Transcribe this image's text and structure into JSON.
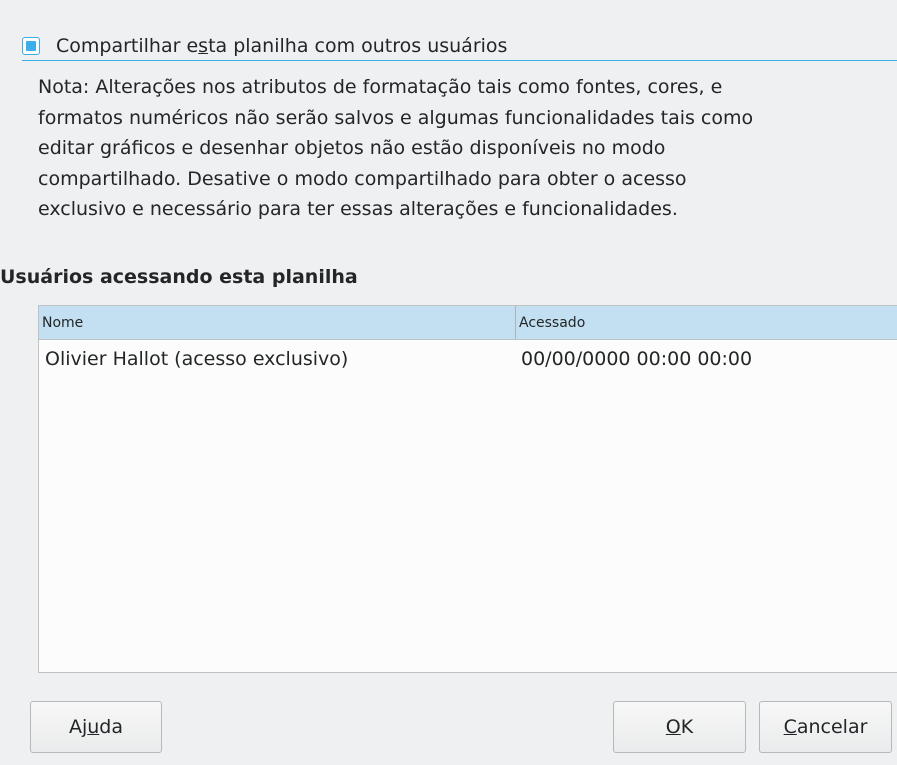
{
  "share": {
    "checked": true,
    "label_before": "Compartilhar e",
    "label_mnemonic": "s",
    "label_after": "ta planilha com outros usuários"
  },
  "note": "Nota: Alterações nos atributos de formatação tais como fontes, cores, e\nformatos numéricos não serão salvos e algumas funcionalidades tais como\neditar gráficos e desenhar objetos não estão disponíveis no modo\ncompartilhado. Desative o modo compartilhado para obter o acesso\nexclusivo e necessário para ter essas alterações e funcionalidades.",
  "users_section": {
    "title": "Usuários acessando esta planilha",
    "columns": {
      "name": "Nome",
      "accessed": "Acessado"
    },
    "rows": [
      {
        "name": "Olivier Hallot (acesso exclusivo)",
        "accessed": "00/00/0000 00:00 00:00"
      }
    ]
  },
  "buttons": {
    "help": {
      "before": "Aj",
      "mnemonic": "u",
      "after": "da"
    },
    "ok": {
      "before": "",
      "mnemonic": "O",
      "after": "K"
    },
    "cancel": {
      "before": "",
      "mnemonic": "C",
      "after": "ancelar"
    }
  },
  "colors": {
    "accent": "#3daee9",
    "header_bg": "#c2e0f2",
    "window_bg": "#eff0f1"
  }
}
